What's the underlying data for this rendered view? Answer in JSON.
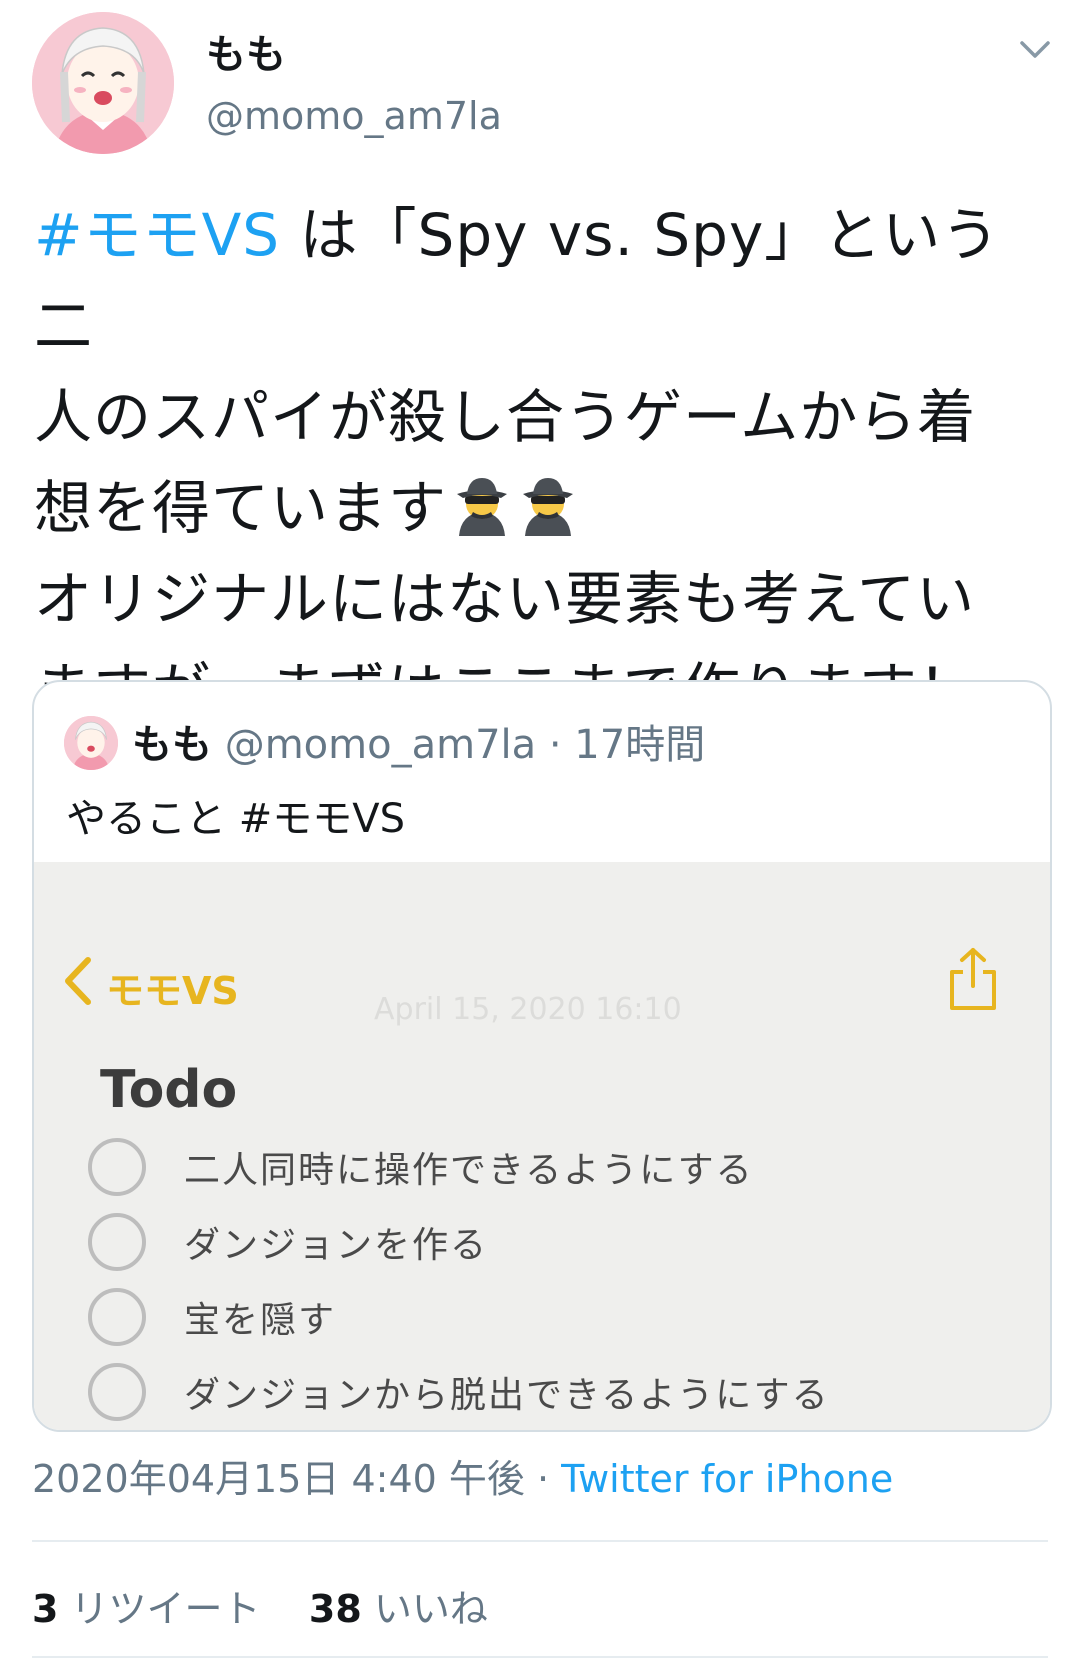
{
  "author": {
    "display_name": "もも",
    "handle": "@momo_am7la"
  },
  "tweet": {
    "hashtag": "#モモVS",
    "text_line1": " は「Spy vs. Spy」という二",
    "text_line2": "人のスパイが殺し合うゲームから着",
    "text_line3": "想を得ています",
    "text_line4": "オリジナルにはない要素も考えてい",
    "text_line5": "ますが、まずはここまで作ります！"
  },
  "quoted_tweet": {
    "display_name": "もも",
    "handle": "@momo_am7la",
    "time_ago": "· 17時間",
    "text": "やること #モモVS",
    "notes": {
      "folder": "モモVS",
      "date": "April 15, 2020 16:10",
      "heading": "Todo",
      "items": [
        "二人同時に操作できるようにする",
        "ダンジョンを作る",
        "宝を隠す",
        "ダンジョンから脱出できるようにする"
      ]
    }
  },
  "meta": {
    "timestamp": "2020年04月15日 4:40 午後 · ",
    "source": "Twitter for iPhone"
  },
  "stats": {
    "retweets_count": "3",
    "retweets_label": " リツイート",
    "likes_count": "38",
    "likes_label": " いいね"
  },
  "colors": {
    "accent": "#1da1f2",
    "notes_accent": "#e7b51f",
    "secondary_text": "#657786"
  }
}
